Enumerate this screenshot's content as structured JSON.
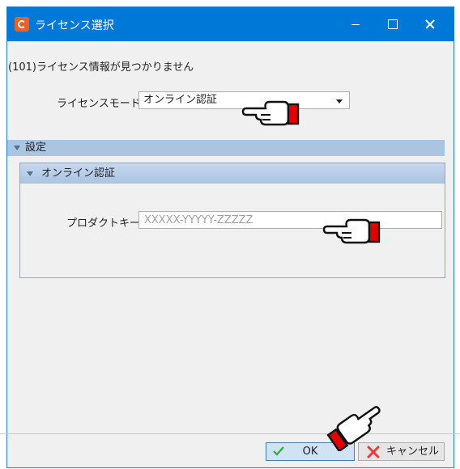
{
  "window": {
    "title": "ライセンス選択"
  },
  "message": "(101)ライセンス情報が見つかりません",
  "license_mode": {
    "label": "ライセンスモード",
    "value": "オンライン認証"
  },
  "section": {
    "label": "設定"
  },
  "subsection": {
    "label": "オンライン認証"
  },
  "product_key": {
    "label": "プロダクトキー",
    "placeholder": "XXXXX-YYYYY-ZZZZZ"
  },
  "buttons": {
    "ok": "OK",
    "cancel": "キャンセル"
  },
  "colors": {
    "titlebar": "#0078d7",
    "section_header": "#abc4e0",
    "pointer_cuff": "#e00000"
  }
}
